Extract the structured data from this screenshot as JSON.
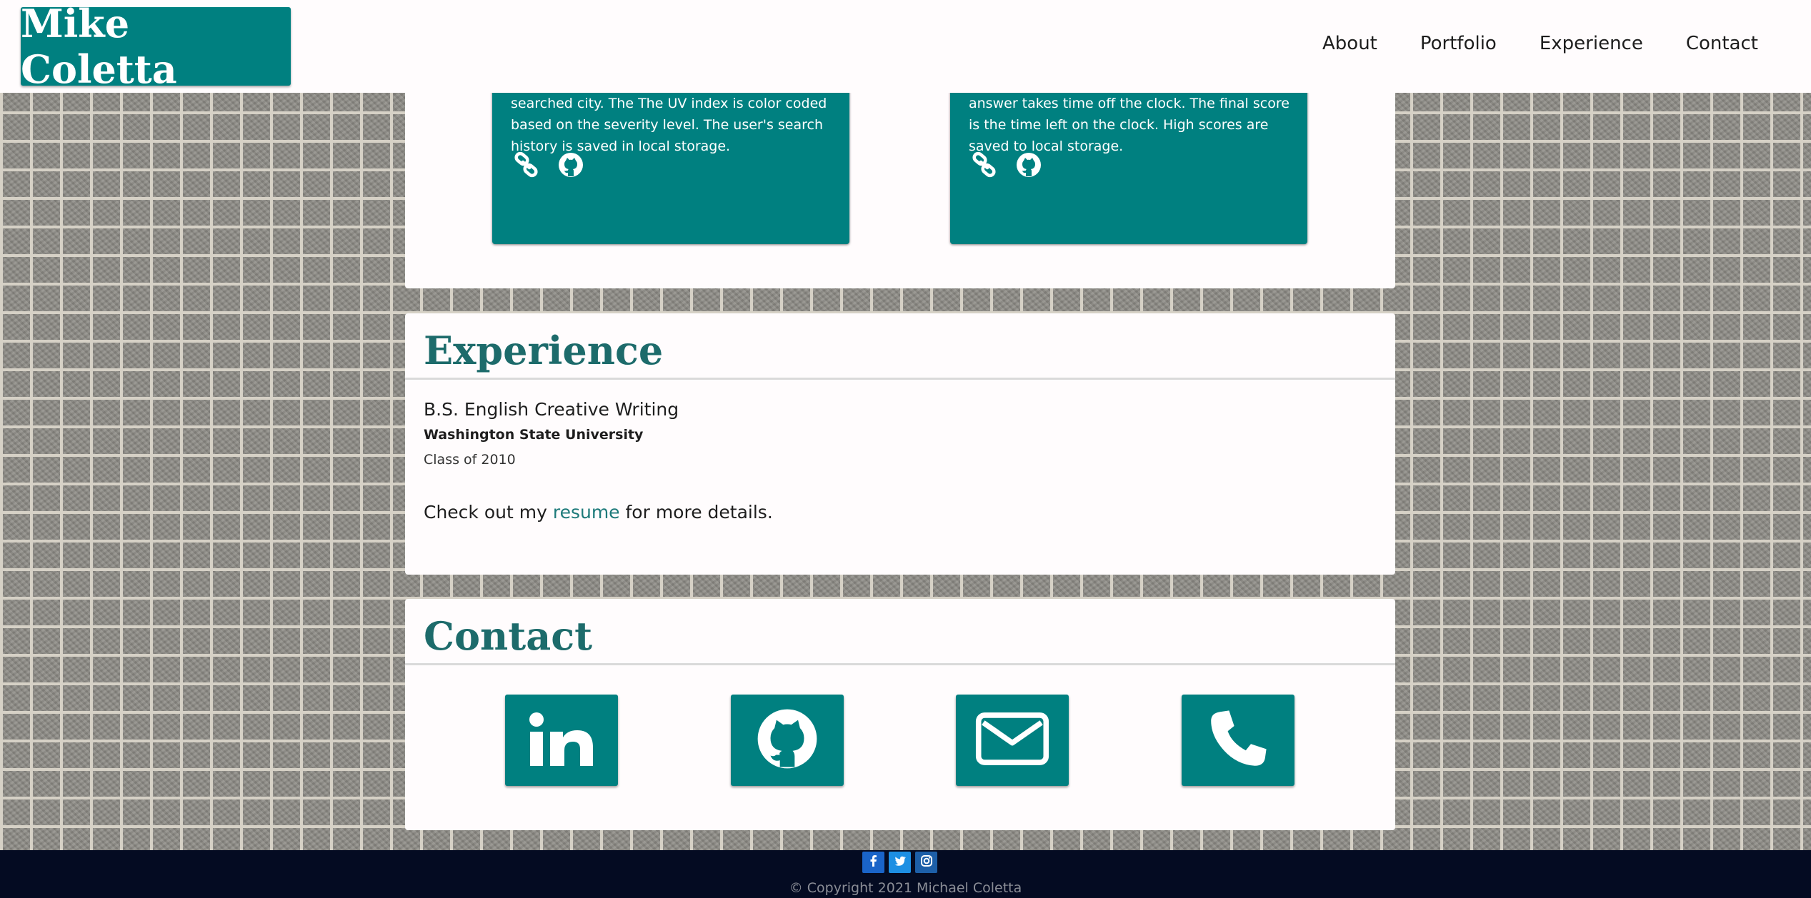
{
  "header": {
    "logo_text": "Mike Coletta",
    "nav": [
      {
        "label": "About"
      },
      {
        "label": "Portfolio"
      },
      {
        "label": "Experience"
      },
      {
        "label": "Contact"
      }
    ]
  },
  "portfolio": {
    "projects": [
      {
        "description": "current weather and the five day forecast for a searched city. The The UV index is color coded based on the severity level. The user's search history is saved in local storage.",
        "link_icon": "link-icon",
        "github_icon": "github-icon"
      },
      {
        "description": "seconds to complete the quiz. Every wrong answer takes time off the clock. The final score is the time left on the clock. High scores are saved to local storage.",
        "link_icon": "link-icon",
        "github_icon": "github-icon"
      }
    ]
  },
  "experience": {
    "title": "Experience",
    "degree": "B.S. English Creative Writing",
    "school": "Washington State University",
    "year": "Class of 2010",
    "resume_prefix": "Check out my ",
    "resume_link": "resume",
    "resume_suffix": " for more details."
  },
  "contact": {
    "title": "Contact",
    "icons": [
      "linkedin-icon",
      "github-icon",
      "envelope-icon",
      "phone-icon"
    ]
  },
  "footer": {
    "socials": [
      "facebook-icon",
      "twitter-icon",
      "instagram-icon"
    ],
    "copyright": "© Copyright 2021 Michael Coletta"
  },
  "colors": {
    "accent": "#008080",
    "title": "#1d6b6b",
    "footer_bg": "#040b22"
  }
}
